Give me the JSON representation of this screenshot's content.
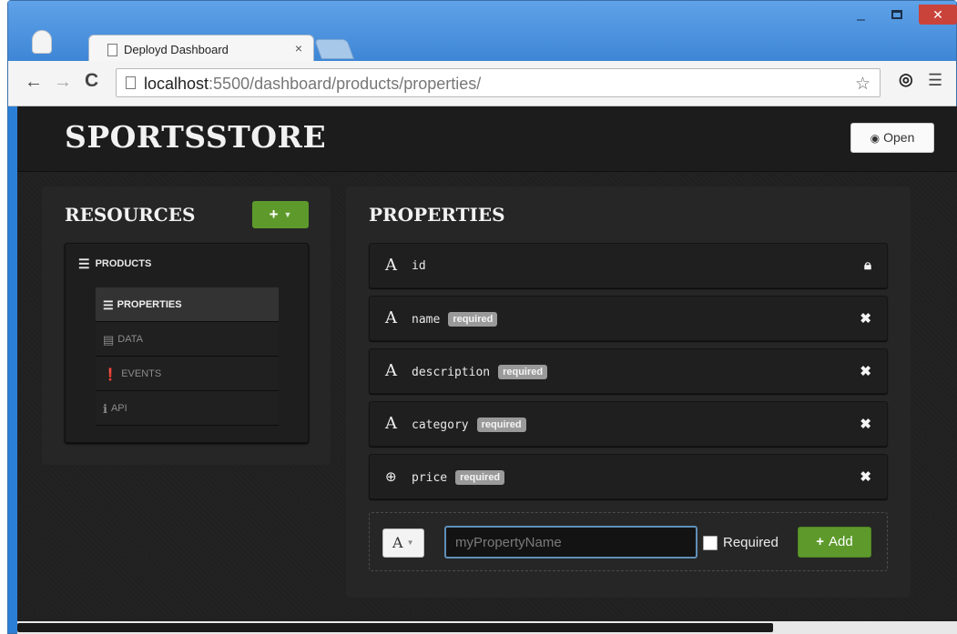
{
  "browser": {
    "tab_title": "Deployd Dashboard",
    "tab_close": "×",
    "url_host": "localhost",
    "url_rest": ":5500/dashboard/products/properties/",
    "window_min": "–",
    "window_close": "✕"
  },
  "header": {
    "brand": "SPORTSSTORE",
    "open_label": "Open"
  },
  "resources": {
    "title": "RESOURCES",
    "add_label": "+",
    "root": "PRODUCTS",
    "items": [
      {
        "label": "PROPERTIES",
        "icon": "list-icon",
        "active": true
      },
      {
        "label": "DATA",
        "icon": "table-icon",
        "active": false
      },
      {
        "label": "EVENTS",
        "icon": "exclamation-icon",
        "active": false
      },
      {
        "label": "API",
        "icon": "info-icon",
        "active": false
      }
    ]
  },
  "properties": {
    "title": "PROPERTIES",
    "rows": [
      {
        "type": "A",
        "name": "id",
        "badge": "",
        "action": "lock"
      },
      {
        "type": "A",
        "name": "name",
        "badge": "required",
        "action": "remove"
      },
      {
        "type": "A",
        "name": "description",
        "badge": "required",
        "action": "remove"
      },
      {
        "type": "A",
        "name": "category",
        "badge": "required",
        "action": "remove"
      },
      {
        "type": "number",
        "name": "price",
        "badge": "required",
        "action": "remove"
      }
    ],
    "new": {
      "type_label": "A",
      "placeholder": "myPropertyName",
      "required_label": "Required",
      "add_label": "Add"
    }
  },
  "colors": {
    "brand_green": "#5d9a2b",
    "page_bg": "#202020",
    "badge_gray": "#9a9a9a"
  }
}
